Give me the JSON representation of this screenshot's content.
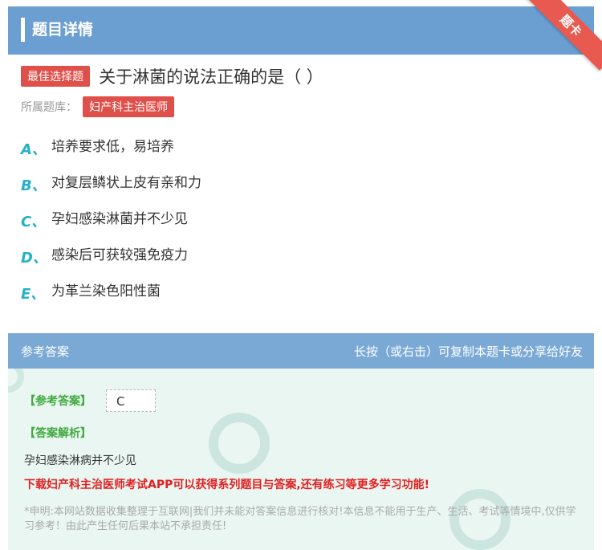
{
  "header": {
    "title": "题目详情",
    "ribbon": "题卡"
  },
  "question": {
    "badge": "最佳选择题",
    "text": "关于淋菌的说法正确的是（ ）",
    "library_label": "所属题库：",
    "library": "妇产科主治医师"
  },
  "options": [
    {
      "letter": "A、",
      "text": "培养要求低，易培养"
    },
    {
      "letter": "B、",
      "text": "对复层鳞状上皮有亲和力"
    },
    {
      "letter": "C、",
      "text": "孕妇感染淋菌并不少见"
    },
    {
      "letter": "D、",
      "text": "感染后可获较强免疫力"
    },
    {
      "letter": "E、",
      "text": "为革兰染色阳性菌"
    }
  ],
  "answer_section": {
    "title": "参考答案",
    "hint": "长按（或右击）可复制本题卡或分享给好友",
    "answer_label": "【参考答案】",
    "answer_value": "C",
    "explain_label": "【答案解析】",
    "explain_text": "孕妇感染淋病并不少见",
    "download": "下载妇产科主治医师考试APP可以获得系列题目与答案,还有练习等更多学习功能!",
    "notice": "*申明:本网站数据收集整理于互联网|我们并未能对答案信息进行核对!本信息不能用于生产、生活、考试等情境中,仅供学习参考！由此产生任何后果本站不承担责任!"
  },
  "colors": {
    "header": "#6c9fd1",
    "badge": "#e0504a",
    "option_letter": "#26b0c9",
    "answer_green": "#3faa3f",
    "download_red": "#e02020"
  }
}
